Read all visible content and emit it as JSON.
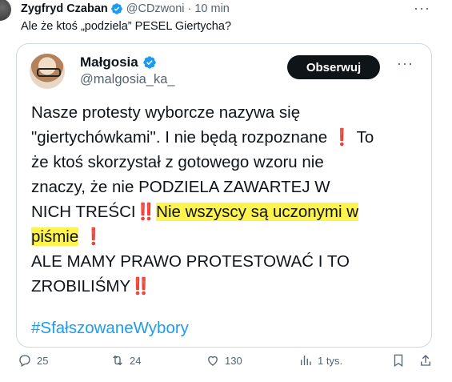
{
  "outer_tweet": {
    "author_name": "Zygfryd Czaban",
    "handle": "@CDzwoni",
    "separator": "·",
    "time": "10 min",
    "text": "Ale że ktoś „podziela” PESEL Giertycha?"
  },
  "quoted_tweet": {
    "author_name": "Małgosia",
    "handle": "@malgosia_ka_",
    "follow_label": "Obserwuj",
    "lines": {
      "l1": "Nasze protesty wyborcze nazywa się",
      "l2a": "\"giertychówkami\". I nie będą rozpoznane",
      "l2b": "To",
      "l3": "że ktoś skorzystał z gotowego wzoru nie",
      "l4": "znaczy, że nie PODZIELA ZAWARTEJ W",
      "l5a": "NICH TREŚCI",
      "l5b": "Nie wszyscy są uczonymi w",
      "l6a": "piśmie",
      "l7": "ALE MAMY PRAWO PROTESTOWAĆ I TO",
      "l8a": "ZROBILIŚMY"
    },
    "emoji": {
      "single": "❗",
      "double": "‼️"
    },
    "hashtag": "#SfałszowaneWybory",
    "highlight_color": "#fff34d"
  },
  "actions": {
    "replies": "25",
    "reposts": "24",
    "likes": "130",
    "views": "1 tys."
  },
  "icons": [
    "verified-badge-icon",
    "more-icon",
    "reply-icon",
    "repost-icon",
    "like-icon",
    "views-icon",
    "share-icon"
  ],
  "colors": {
    "text": "#0f1419",
    "secondary": "#536471",
    "link": "#1d9bf0",
    "verified": "#1d9bf0",
    "button_bg": "#0f1419"
  }
}
